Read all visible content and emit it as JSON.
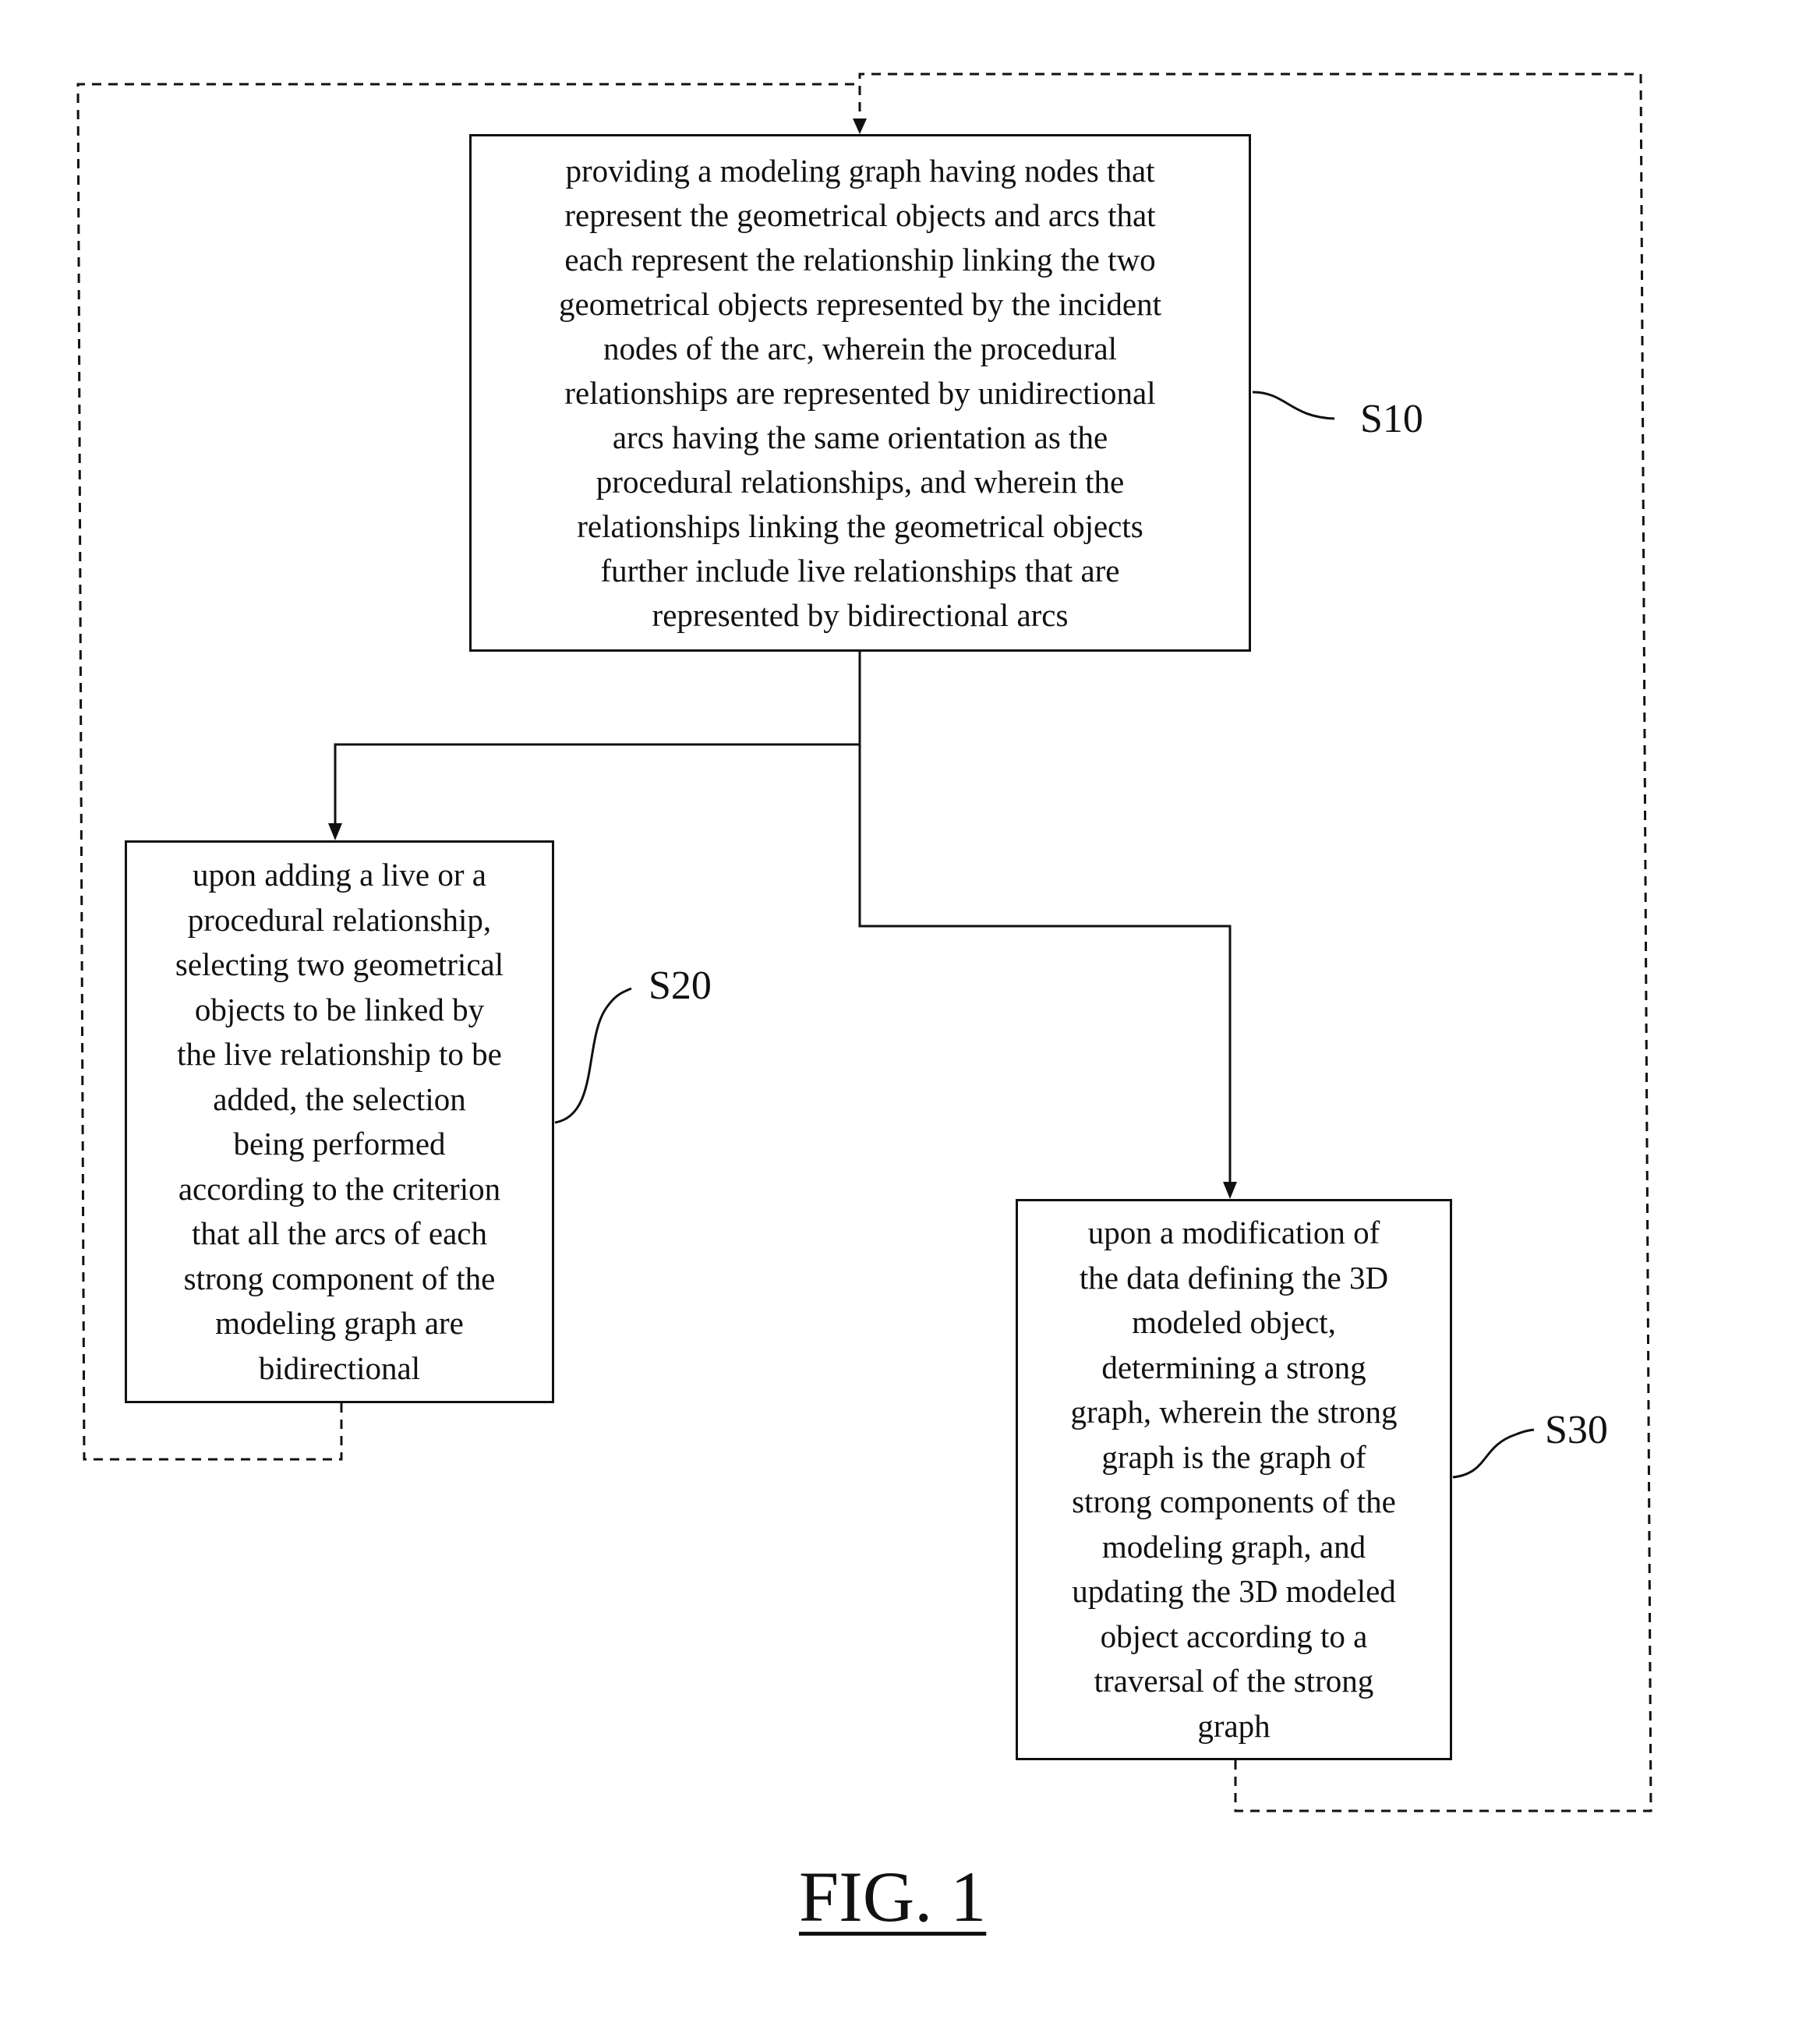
{
  "figure": {
    "title": "FIG. 1",
    "steps": [
      {
        "id": "S10",
        "text": "providing a modeling graph having nodes that\nrepresent the geometrical objects and arcs that\neach represent the relationship linking the two\ngeometrical objects represented by the incident\nnodes of the arc, wherein the procedural\nrelationships are represented by unidirectional\narcs having the same orientation as the\nprocedural relationships, and wherein the\nrelationships linking the geometrical objects\nfurther include live relationships that are\nrepresented by bidirectional arcs"
      },
      {
        "id": "S20",
        "text": "upon adding a live or a\nprocedural  relationship,\nselecting two geometrical\nobjects to be linked by\nthe live relationship to be\nadded, the selection\nbeing performed\naccording to the criterion\nthat all the arcs of each\nstrong component of the\nmodeling graph are\nbidirectional"
      },
      {
        "id": "S30",
        "text": "upon a modification of\nthe data defining the 3D\nmodeled object,\ndetermining a strong\ngraph, wherein the strong\ngraph is the graph of\nstrong components of the\nmodeling graph, and\nupdating the 3D modeled\nobject according to a\ntraversal of the strong\ngraph"
      }
    ],
    "edges": [
      {
        "from": "S10",
        "to": "S20",
        "style": "solid"
      },
      {
        "from": "S10",
        "to": "S30",
        "style": "solid"
      },
      {
        "from": "S20",
        "to": "S10",
        "style": "dashed"
      },
      {
        "from": "S30",
        "to": "S10",
        "style": "dashed"
      }
    ]
  }
}
